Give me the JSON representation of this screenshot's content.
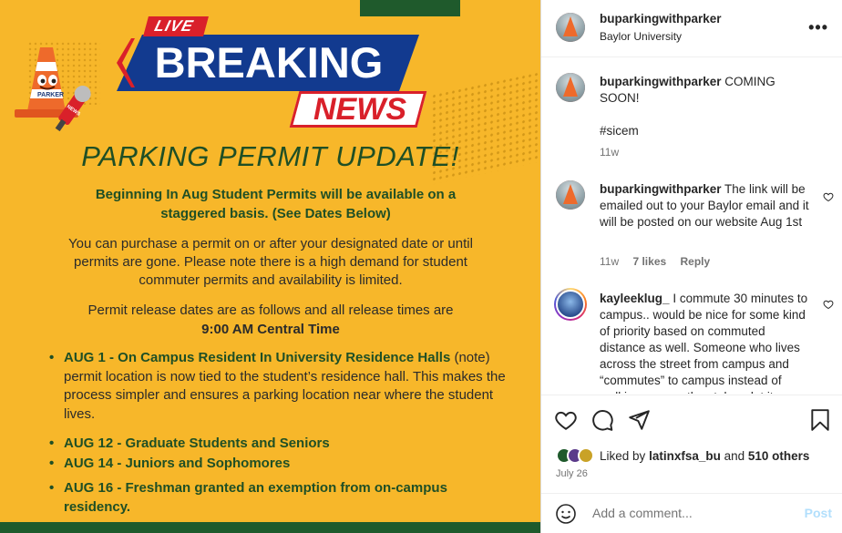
{
  "post_image": {
    "live_label": "LIVE",
    "breaking_label": "BREAKING",
    "news_label": "NEWS",
    "mascot_hat_text": "PARKER",
    "mascot_mic_text": "NEWS",
    "headline": "PARKING PERMIT UPDATE!",
    "subheadline": "Beginning In Aug Student Permits will be available on a staggered basis.  (See Dates Below)",
    "paragraph": "You can purchase a permit on or after your designated date or until permits are gone.  Please note there is a high demand for student commuter permits and availability is limited.",
    "release_intro": "Permit release dates are as follows and all release times are",
    "release_time": "9:00 AM Central Time",
    "bullets": [
      {
        "lead": "AUG 1 - On Campus Resident In University Residence Halls",
        "rest": " (note) permit location is now tied to the student’s residence hall. This makes the process simpler and ensures a parking location near where the student lives."
      },
      {
        "lead": "AUG 12 - Graduate Students and Seniors",
        "rest": ""
      },
      {
        "lead": "AUG 14 - Juniors and Sophomores",
        "rest": ""
      },
      {
        "lead": "AUG 16 - Freshman granted an exemption from on-campus residency.",
        "rest": ""
      }
    ],
    "colors": {
      "background": "#f7b72a",
      "green": "#1f4f25",
      "red": "#d9202a",
      "blue": "#123a8f"
    }
  },
  "header": {
    "username": "buparkingwithparker",
    "location": "Baylor University",
    "more_icon": "more-horizontal-icon"
  },
  "caption": {
    "username": "buparkingwithparker",
    "text": "COMING SOON!",
    "hashtag": "#sicem",
    "time": "11w"
  },
  "comments": [
    {
      "username": "buparkingwithparker",
      "text": "The link will be emailed out to your Baylor email and it will be posted on our website Aug 1st",
      "time": "11w",
      "likes": "7 likes",
      "reply": "Reply"
    },
    {
      "username": "kayleeklug_",
      "text": "I commute 30 minutes to campus.. would be nice for some kind of priority based on commuted distance as well. Someone who lives across the street from campus and “commutes” to campus instead of walking, seems they take a lot it",
      "time": "",
      "likes": "",
      "reply": ""
    }
  ],
  "actions": {
    "like_icon": "heart-icon",
    "comment_icon": "comment-icon",
    "share_icon": "send-icon",
    "save_icon": "bookmark-icon",
    "liked_by_prefix": "Liked by",
    "liked_by_user": "latinxfsa_bu",
    "liked_by_and": "and",
    "liked_by_others": "510 others",
    "date": "July 26"
  },
  "add_comment": {
    "emoji_icon": "smiley-icon",
    "placeholder": "Add a comment...",
    "post_label": "Post"
  }
}
